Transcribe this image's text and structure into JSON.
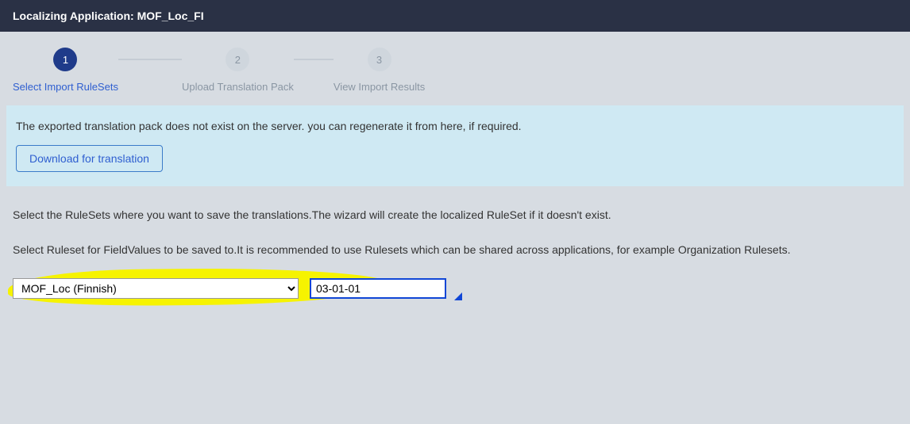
{
  "header": {
    "title": "Localizing Application: MOF_Loc_FI"
  },
  "steps": [
    {
      "num": "1",
      "label": "Select Import RuleSets",
      "active": true
    },
    {
      "num": "2",
      "label": "Upload Translation Pack",
      "active": false
    },
    {
      "num": "3",
      "label": "View Import Results",
      "active": false
    }
  ],
  "banner": {
    "text": "The exported translation pack does not exist on the server. you can regenerate it from here, if required.",
    "button_label": "Download for translation"
  },
  "content": {
    "paragraph1": "Select the RuleSets where you want to save the translations.The wizard will create the localized RuleSet if it doesn't exist.",
    "paragraph2": "Select Ruleset for FieldValues to be saved to.It is recommended to use Rulesets which can be shared across applications, for example Organization Rulesets."
  },
  "form": {
    "ruleset_option": "MOF_Loc (Finnish)",
    "version_value": "03-01-01"
  }
}
